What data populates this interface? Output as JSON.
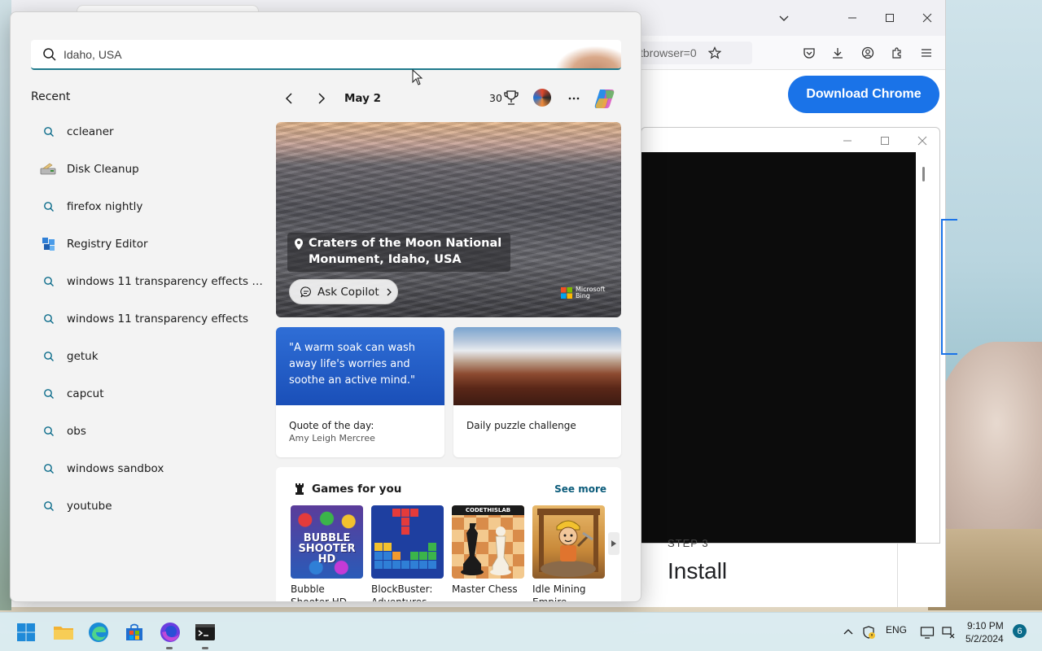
{
  "browser": {
    "url_fragment": "tbrowser=0",
    "download_button": "Download Chrome",
    "step_label": "STEP 3",
    "step_title": "Install"
  },
  "search": {
    "placeholder": "Idaho, USA"
  },
  "recent": {
    "heading": "Recent",
    "items": [
      {
        "label": "ccleaner",
        "icon": "search-icon"
      },
      {
        "label": "Disk Cleanup",
        "icon": "disk-cleanup-icon"
      },
      {
        "label": "firefox nightly",
        "icon": "search-icon"
      },
      {
        "label": "Registry Editor",
        "icon": "registry-editor-icon"
      },
      {
        "label": "windows 11 transparency effects wina...",
        "icon": "search-icon"
      },
      {
        "label": "windows 11 transparency effects",
        "icon": "search-icon"
      },
      {
        "label": "getuk",
        "icon": "search-icon"
      },
      {
        "label": "capcut",
        "icon": "search-icon"
      },
      {
        "label": "obs",
        "icon": "search-icon"
      },
      {
        "label": "windows sandbox",
        "icon": "search-icon"
      },
      {
        "label": "youtube",
        "icon": "search-icon"
      }
    ]
  },
  "widgets": {
    "date": "May 2",
    "points": "30",
    "hero": {
      "caption": "Craters of the Moon National Monument, Idaho, USA",
      "ask_copilot": "Ask Copilot",
      "brand_line1": "Microsoft",
      "brand_line2": "Bing"
    },
    "quote": {
      "text": "\"A warm soak can wash away life's worries and soothe an active mind.\"",
      "title": "Quote of the day:",
      "author": "Amy Leigh Mercree"
    },
    "puzzle": {
      "title": "Daily puzzle challenge"
    },
    "games": {
      "heading": "Games for you",
      "see_more": "See more",
      "items": [
        {
          "label": "Bubble Shooter HD",
          "tile_text": "BUBBLE SHOOTER HD"
        },
        {
          "label": "BlockBuster: Adventures"
        },
        {
          "label": "Master Chess",
          "tile_text": "CODETHISLAB"
        },
        {
          "label": "Idle Mining Empire"
        }
      ]
    }
  },
  "taskbar": {
    "language": "ENG",
    "time": "9:10 PM",
    "date": "5/2/2024",
    "notifications": "6"
  },
  "colors": {
    "accent": "#1a73e8",
    "search_underline": "#1f7a8c",
    "quote_card": "#2f6ed6"
  }
}
